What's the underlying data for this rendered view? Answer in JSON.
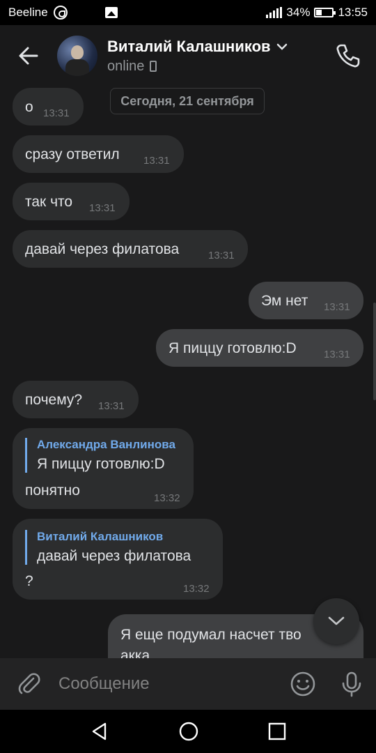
{
  "status_bar": {
    "carrier": "Beeline",
    "battery": "34%",
    "time": "13:55"
  },
  "header": {
    "name": "Виталий Калашников",
    "status": "online"
  },
  "date_separator": "Сегодня, 21 сентября",
  "messages": [
    {
      "text": "о",
      "time": "13:31",
      "outgoing": false
    },
    {
      "text": "сразу ответил",
      "time": "13:31",
      "outgoing": false
    },
    {
      "text": "так что",
      "time": "13:31",
      "outgoing": false
    },
    {
      "text": "давай через филатова",
      "time": "13:31",
      "outgoing": false
    },
    {
      "text": "Эм нет",
      "time": "13:31",
      "outgoing": true
    },
    {
      "text": "Я пиццу готовлю:D",
      "time": "13:31",
      "outgoing": true
    },
    {
      "text": "почему?",
      "time": "13:31",
      "outgoing": false
    },
    {
      "reply_author": "Александра Ванлинова",
      "reply_text": "Я пиццу готовлю:D",
      "text": "понятно",
      "time": "13:32",
      "outgoing": false
    },
    {
      "reply_author": "Виталий Калашников",
      "reply_text": "давай через филатова",
      "text": "?",
      "time": "13:32",
      "outgoing": false
    },
    {
      "text": "Я еще подумал насчет тво",
      "text_line2": "акка",
      "outgoing": true
    }
  ],
  "composer": {
    "placeholder": "Сообщение"
  },
  "icons": {
    "back": "back-arrow-icon",
    "call": "phone-icon",
    "attach": "paperclip-icon",
    "emoji": "smiley-icon",
    "mic": "microphone-icon",
    "scroll": "chevron-down-icon"
  },
  "colors": {
    "background": "#19191a",
    "bubble_in": "#2c2d2e",
    "bubble_out": "#3f4042",
    "reply_accent": "#71aaeb"
  }
}
